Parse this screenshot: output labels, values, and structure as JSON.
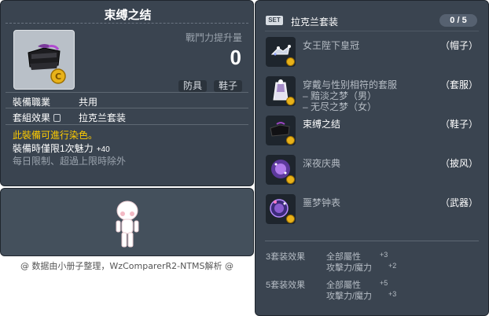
{
  "item_id": "01073647",
  "item": {
    "name": "束缚之结",
    "power_label": "戰鬥力提升量",
    "power_value": "0",
    "tags": [
      "防具",
      "鞋子"
    ],
    "job_label": "裝備職業",
    "job_value": "共用",
    "set_label": "套組效果",
    "set_value": "拉克兰套装",
    "dye_note": "此裝備可進行染色。",
    "charm_note": "裝備時僅限1次魅力",
    "charm_value": "+40",
    "limit_note": "每日限制、超過上限時除外"
  },
  "credit": "@ 数据由小册子整理，WzComparerR2-NTMS解析 @",
  "set_panel": {
    "badge": "SET",
    "name": "拉克兰套装",
    "count": "0 / 5",
    "items": [
      {
        "name": "女王陛下皇冠",
        "category": "（帽子）",
        "owned": false
      },
      {
        "name": "穿戴与性别相符的套服",
        "category": "（套服）",
        "owned": false,
        "sub": [
          "– 黯淡之梦（男）",
          "– 无尽之梦（女）"
        ]
      },
      {
        "name": "束缚之结",
        "category": "（鞋子）",
        "owned": true
      },
      {
        "name": "深夜庆典",
        "category": "（披风）",
        "owned": false
      },
      {
        "name": "噩梦钟表",
        "category": "（武器）",
        "owned": false
      }
    ],
    "effects": [
      {
        "label": "3套装效果",
        "stats": [
          {
            "name": "全部屬性",
            "value": "+3"
          },
          {
            "name": "攻擊力/魔力",
            "value": "+2"
          }
        ]
      },
      {
        "label": "5套装效果",
        "stats": [
          {
            "name": "全部屬性",
            "value": "+5"
          },
          {
            "name": "攻擊力/魔力",
            "value": "+3"
          }
        ]
      }
    ]
  },
  "colors": {
    "panel_bg": "#3a4450",
    "dye_note": "#ffcc00",
    "coin": "#e8b21a"
  },
  "icons": [
    "shoe-knot-icon",
    "crown-icon",
    "overall-icon",
    "cape-icon",
    "clock-weapon-icon",
    "coin-icon",
    "lock-icon",
    "character-avatar"
  ]
}
